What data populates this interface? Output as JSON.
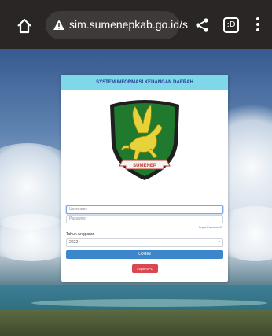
{
  "browser": {
    "url": "sim.sumenepkab.go.id/s",
    "tab_count": ":D",
    "icons": [
      "home-icon",
      "warning-icon",
      "share-icon",
      "tabs-icon",
      "more-menu-icon"
    ]
  },
  "card": {
    "title": "SYSTEM INFORMASI KEUANGAN DAERAH",
    "logo_banner": "SUMENEP",
    "username_placeholder": "Username",
    "password_placeholder": "Password",
    "forgot_label": "Lupa Password?",
    "year_label": "Tahun Anggaran",
    "year_value": "2022",
    "login_label": "LOGIN",
    "sipd_label": "Login SIPD"
  },
  "colors": {
    "header_bg": "#7fd7ea",
    "login_button": "#3c86cb",
    "sipd_button": "#d9484e",
    "shield_green": "#1f7a2e"
  }
}
